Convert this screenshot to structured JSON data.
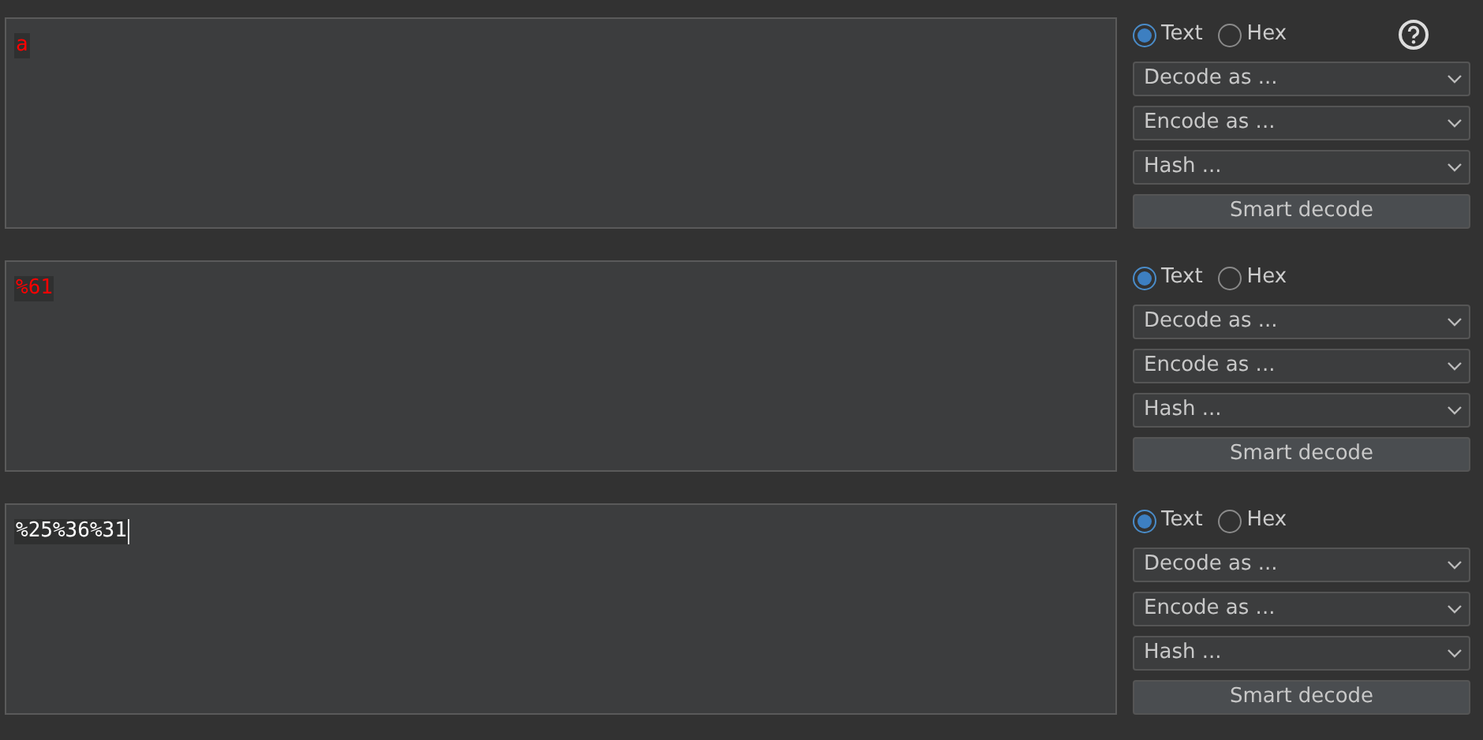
{
  "panels": [
    {
      "content": "a",
      "color": "#ff0000",
      "cursor": false,
      "help": true,
      "modes": [
        {
          "label": "Text",
          "selected": true
        },
        {
          "label": "Hex",
          "selected": false
        }
      ],
      "dropdowns": [
        "Decode as ...",
        "Encode as ...",
        "Hash ..."
      ],
      "button": "Smart decode"
    },
    {
      "content": "%61",
      "color": "#ff0000",
      "cursor": false,
      "help": false,
      "modes": [
        {
          "label": "Text",
          "selected": true
        },
        {
          "label": "Hex",
          "selected": false
        }
      ],
      "dropdowns": [
        "Decode as ...",
        "Encode as ...",
        "Hash ..."
      ],
      "button": "Smart decode"
    },
    {
      "content": "%25%36%31",
      "color": "#ffffff",
      "cursor": true,
      "help": false,
      "modes": [
        {
          "label": "Text",
          "selected": true
        },
        {
          "label": "Hex",
          "selected": false
        }
      ],
      "dropdowns": [
        "Decode as ...",
        "Encode as ...",
        "Hash ..."
      ],
      "button": "Smart decode"
    }
  ]
}
